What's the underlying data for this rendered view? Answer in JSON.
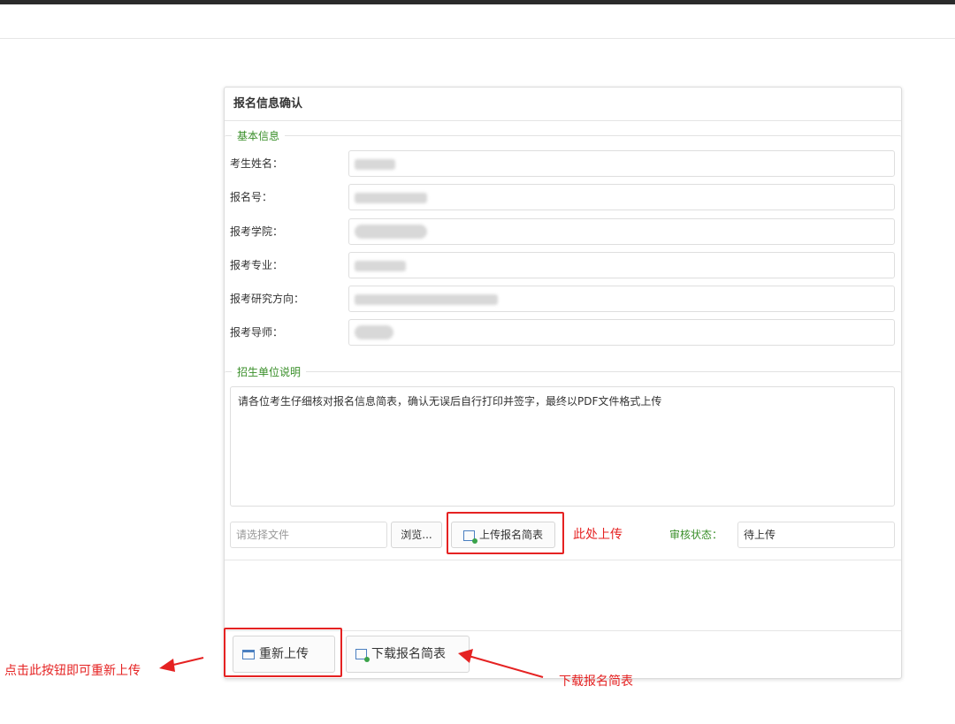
{
  "panel": {
    "title": "报名信息确认"
  },
  "basic_info": {
    "legend": "基本信息",
    "fields": [
      {
        "label": "考生姓名："
      },
      {
        "label": "报名号："
      },
      {
        "label": "报考学院："
      },
      {
        "label": "报考专业："
      },
      {
        "label": "报考研究方向："
      },
      {
        "label": "报考导师："
      }
    ]
  },
  "notice_section": {
    "legend": "招生单位说明",
    "text": "请各位考生仔细核对报名信息简表，确认无误后自行打印并签字，最终以PDF文件格式上传"
  },
  "upload": {
    "file_placeholder": "请选择文件",
    "browse_label": "浏览...",
    "upload_label": "上传报名简表",
    "status_label": "审核状态：",
    "status_value": "待上传"
  },
  "footer": {
    "reupload_label": "重新上传",
    "download_label": "下载报名简表"
  },
  "annotations": {
    "upload_here": "此处上传",
    "reupload_hint": "点击此按钮即可重新上传",
    "download_hint": "下载报名简表"
  },
  "colors": {
    "legend_green": "#3a8f2a",
    "annotation_red": "#e52222",
    "icon_blue": "#4a7fc0"
  }
}
